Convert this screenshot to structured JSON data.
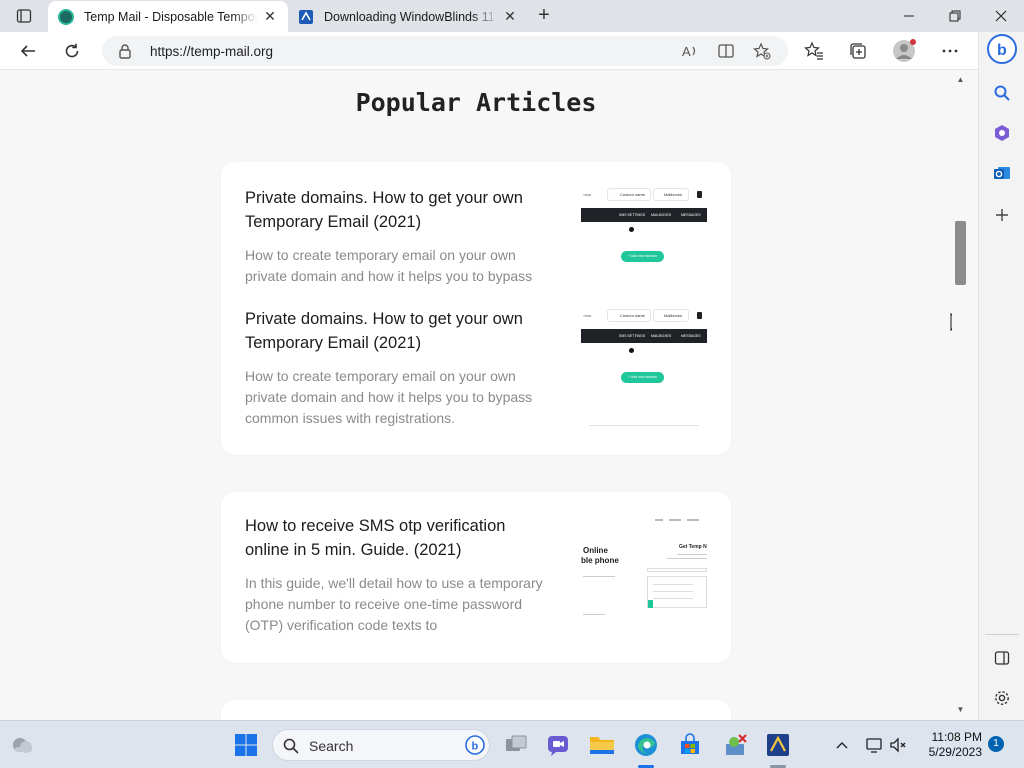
{
  "browser": {
    "tabs": [
      {
        "title": "Temp Mail - Disposable Temporary Email",
        "active": true
      },
      {
        "title": "Downloading WindowBlinds 11 ...",
        "active": false
      }
    ],
    "url": "https://temp-mail.org"
  },
  "page": {
    "section_title": "Popular Articles",
    "articles": [
      {
        "title": "Private domains. How to get your own Temporary Email (2021)",
        "desc": "How to create temporary email on your own private domain and how it helps you to bypass"
      },
      {
        "title": "Private domains. How to get your own Temporary Email (2021)",
        "desc": "How to create temporary email on your own private domain and how it helps you to bypass common issues with registrations."
      },
      {
        "title": "How to receive SMS otp verification online in 5 min. Guide. (2021)",
        "desc": "In this guide, we'll detail how to use a temporary phone number to receive one-time password (OTP) verification code texts to"
      }
    ],
    "thumb_domains": {
      "top_btn_1": "Custom name",
      "top_btn_2": "Mailboxes",
      "col_1": "SMS SETTINGS",
      "col_2": "MAILBOXES",
      "col_3": "MESSAGES",
      "add_btn": "+ Add new domain"
    },
    "thumb_sms": {
      "line1": "Online",
      "line2": "ble phone",
      "right_title": "Get Temp N"
    }
  },
  "taskbar": {
    "search_placeholder": "Search",
    "time": "11:08 PM",
    "date": "5/29/2023",
    "notification_count": "1"
  },
  "colors": {
    "accent_green": "#1fc79a",
    "tab_strip": "#dfe3e8",
    "page_bg": "#f7f7f7",
    "taskbar": "#dde4ed"
  }
}
